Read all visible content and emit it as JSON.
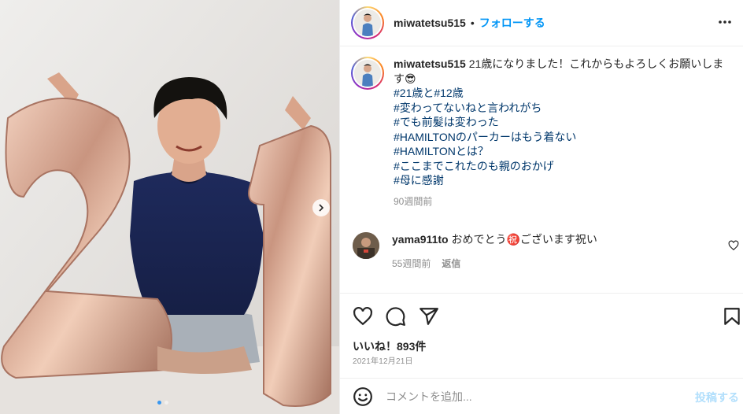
{
  "post": {
    "username": "miwatetsu515",
    "dot": "•",
    "follow_label": "フォローする"
  },
  "caption": {
    "username": "miwatetsu515",
    "text": " 21歳になりました！これからもよろしくお願いします😎",
    "hashtags": [
      "#21歳と#12歳",
      "#変わってないねと言われがち",
      "#でも前髪は変わった",
      "#HAMILTONのパーカーはもう着ない",
      "#HAMILTONとは？",
      "#ここまでこれたのも親のおかげ",
      "#母に感謝"
    ],
    "time": "90週間前"
  },
  "comment": {
    "username": "yama911to",
    "text": " おめでとう㊗️ございます祝い",
    "time": "55週間前",
    "reply_label": "返信"
  },
  "likes": "いいね！893件",
  "date": "2021年12月21日",
  "comment_input": {
    "placeholder": "コメントを追加...",
    "post_label": "投稿する"
  },
  "icons": {
    "more": "more-horizontal-icon",
    "like": "heart-icon",
    "comment": "comment-icon",
    "share": "paper-plane-icon",
    "save": "bookmark-icon",
    "emoji": "emoji-icon",
    "next": "chevron-right-icon"
  },
  "colors": {
    "link": "#0095f6",
    "hashtag": "#00376b",
    "muted": "#8e8e8e",
    "text": "#262626",
    "post_disabled": "#b2dffc"
  },
  "carousel": {
    "slides": 2,
    "active": 1
  }
}
